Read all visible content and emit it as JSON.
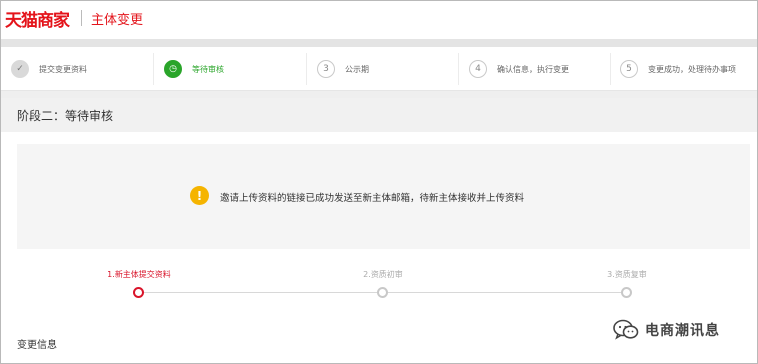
{
  "header": {
    "logo_text": "天猫商家",
    "title": "主体变更"
  },
  "steps": [
    {
      "number": "✓",
      "label": "提交变更资料",
      "state": "done"
    },
    {
      "number": "◷",
      "label": "等待审核",
      "state": "active"
    },
    {
      "number": "3",
      "label": "公示期",
      "state": "pending"
    },
    {
      "number": "4",
      "label": "确认信息，执行变更",
      "state": "pending"
    },
    {
      "number": "5",
      "label": "变更成功，处理待办事项",
      "state": "pending"
    }
  ],
  "stage": {
    "title": "阶段二：等待审核"
  },
  "notice": {
    "icon": "warning-icon",
    "message": "邀请上传资料的链接已成功发送至新主体邮箱，待新主体接收并上传资料"
  },
  "progress": [
    {
      "label": "1.新主体提交资料",
      "state": "active"
    },
    {
      "label": "2.资质初审",
      "state": "pending"
    },
    {
      "label": "3.资质复审",
      "state": "pending"
    }
  ],
  "section": {
    "title": "变更信息"
  },
  "watermark": {
    "icon": "wechat-icon",
    "text": "电商潮讯息"
  },
  "colors": {
    "brand_red": "#e4141b",
    "active_green": "#2aa52a",
    "warning_yellow": "#f5b400",
    "progress_red": "#d9142a"
  }
}
